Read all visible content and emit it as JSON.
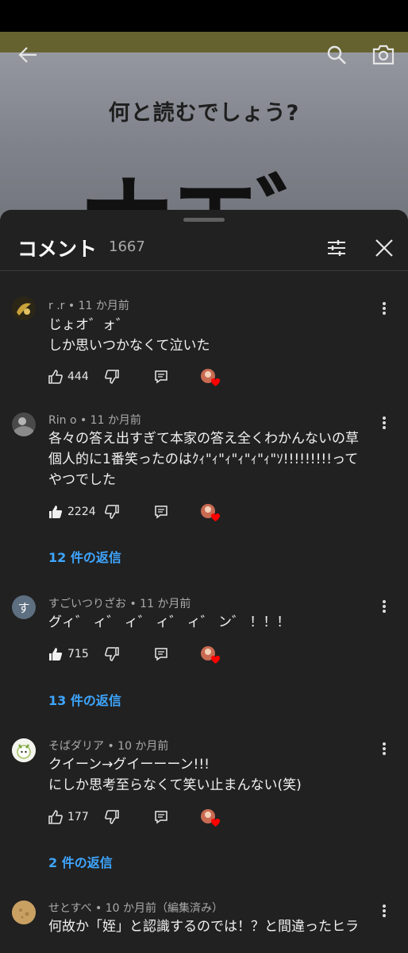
{
  "video": {
    "title": "何と読むでしょう?",
    "big_text": "ナエ゛"
  },
  "header": {
    "title": "コメント",
    "count": "1667"
  },
  "comments": [
    {
      "author_meta": "r .r • 11 か月前",
      "text": "じょオ゛ォ゛\nしか思いつかなくて泣いた",
      "likes": "444"
    },
    {
      "author_meta": "Rin o • 11 か月前",
      "text": "各々の答え出すぎて本家の答え全くわかんないの草\n個人的に1番笑ったのはｸｨ\"ｨ\"ｨ\"ｨ\"ｨ\"ｨ\"ｿ!!!!!!!!!って\nやつでした",
      "likes": "2224",
      "replies": "12 件の返信"
    },
    {
      "author_meta": "すごいつりざお • 11 か月前",
      "text": "グィ゛ ィ゛ ィ゛ ィ゛ ィ゛ ン゛ ！！！",
      "likes": "715",
      "replies": "13 件の返信",
      "avatar_letter": "す"
    },
    {
      "author_meta": "そばダリア • 10 か月前",
      "text": "クイーン→グイーーーン!!!\nにしか思考至らなくて笑い止まんない(笑)",
      "likes": "177",
      "replies": "2 件の返信"
    },
    {
      "author_meta": "せとすべ • 10 か月前（編集済み）",
      "text": "何故か「姪」と認識するのでは！？と間違ったヒラ"
    }
  ],
  "colors": {
    "accent_link": "#3ea6ff",
    "background": "#212121",
    "heart": "#ff0000"
  }
}
